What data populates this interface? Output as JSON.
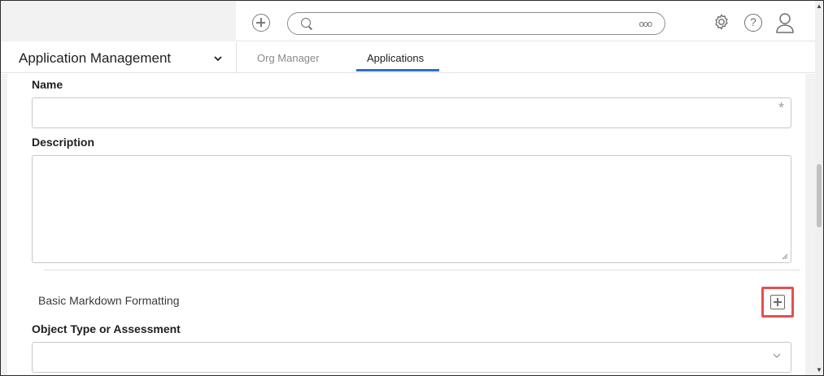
{
  "header": {
    "search_placeholder": "",
    "more_icon": "ooo",
    "help_glyph": "?"
  },
  "nav": {
    "app_title": "Application Management",
    "tabs": [
      {
        "label": "Org Manager",
        "active": false
      },
      {
        "label": "Applications",
        "active": true
      }
    ]
  },
  "form": {
    "name_label": "Name",
    "name_value": "",
    "required_marker": "*",
    "description_label": "Description",
    "description_value": "",
    "markdown_text": "Basic Markdown Formatting",
    "object_type_label": "Object Type or Assessment",
    "object_type_value": ""
  },
  "colors": {
    "accent": "#2e6fc9",
    "highlight": "#e2514f"
  },
  "icons": [
    "add-circle-icon",
    "search-icon",
    "more-icon",
    "gear-icon",
    "help-icon",
    "user-icon",
    "chevron-down-icon",
    "expand-plus-icon"
  ]
}
